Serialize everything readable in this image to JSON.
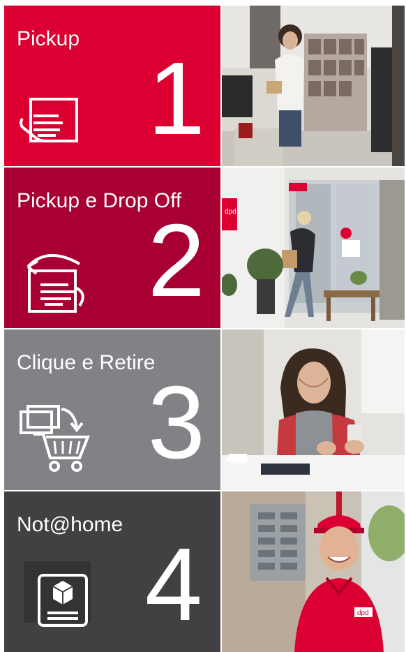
{
  "tiles": [
    {
      "title": "Pickup",
      "number": "1",
      "icon": "hand-on-parcel-icon",
      "color": "#dc0032"
    },
    {
      "title": "Pickup e Drop Off",
      "number": "2",
      "icon": "parcel-return-hand-icon",
      "color": "#a90034"
    },
    {
      "title": "Clique e Retire",
      "number": "3",
      "icon": "shopping-cart-icon",
      "color": "#808285"
    },
    {
      "title": "Not@home",
      "number": "4",
      "icon": "parcel-box-icon",
      "color": "#414042"
    }
  ],
  "photos": [
    {
      "label": "woman at pickup shop counter"
    },
    {
      "label": "person entering parcel shop"
    },
    {
      "label": "woman smiling at smartphone"
    },
    {
      "label": "courier in red uniform"
    }
  ],
  "brand_tags": {
    "shop_sign": "dpd",
    "shirt_logo": "dpd"
  }
}
